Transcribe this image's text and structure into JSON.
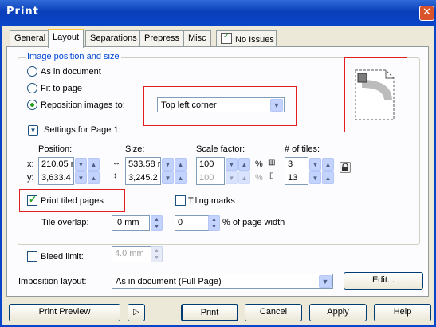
{
  "window": {
    "title": "Print",
    "close_glyph": "✕"
  },
  "tabs": [
    {
      "label": "General"
    },
    {
      "label": "Layout"
    },
    {
      "label": "Separations"
    },
    {
      "label": "Prepress"
    },
    {
      "label": "Misc"
    },
    {
      "label": "No Issues"
    }
  ],
  "image_position": {
    "group_title": "Image position and size",
    "as_in_document": "As in document",
    "fit_to_page": "Fit to page",
    "reposition": "Reposition images to:",
    "reposition_value": "Top left corner"
  },
  "settings": {
    "header": "Settings for Page 1:",
    "position_label": "Position:",
    "size_label": "Size:",
    "scale_label": "Scale factor:",
    "tiles_label": "# of tiles:",
    "x_label": "x:",
    "y_label": "y:",
    "x_value": "210.05 r",
    "y_value": "3,633.4",
    "width": "533.58 r",
    "height": "3,245.2",
    "scale_x": "100",
    "scale_y": "100",
    "percent": "%",
    "tiles_x": "3",
    "tiles_y": "13"
  },
  "tiling": {
    "print_tiled": "Print tiled pages",
    "print_tiled_checked": true,
    "tiling_marks": "Tiling marks",
    "tile_overlap_label": "Tile overlap:",
    "tile_overlap_value": ".0 mm",
    "percent_value": "0",
    "percent_label": "% of page width"
  },
  "bleed": {
    "label": "Bleed limit:",
    "value": "4.0 mm"
  },
  "imposition": {
    "label": "Imposition layout:",
    "value": "As in document (Full Page)",
    "edit": "Edit..."
  },
  "footer": {
    "print_preview": "Print Preview",
    "preview_toggle": "▷",
    "print": "Print",
    "cancel": "Cancel",
    "apply": "Apply",
    "help": "Help"
  },
  "colors": {
    "accent": "#0846c8",
    "group_title": "#0046d5",
    "highlight_box": "#e21f1f"
  }
}
